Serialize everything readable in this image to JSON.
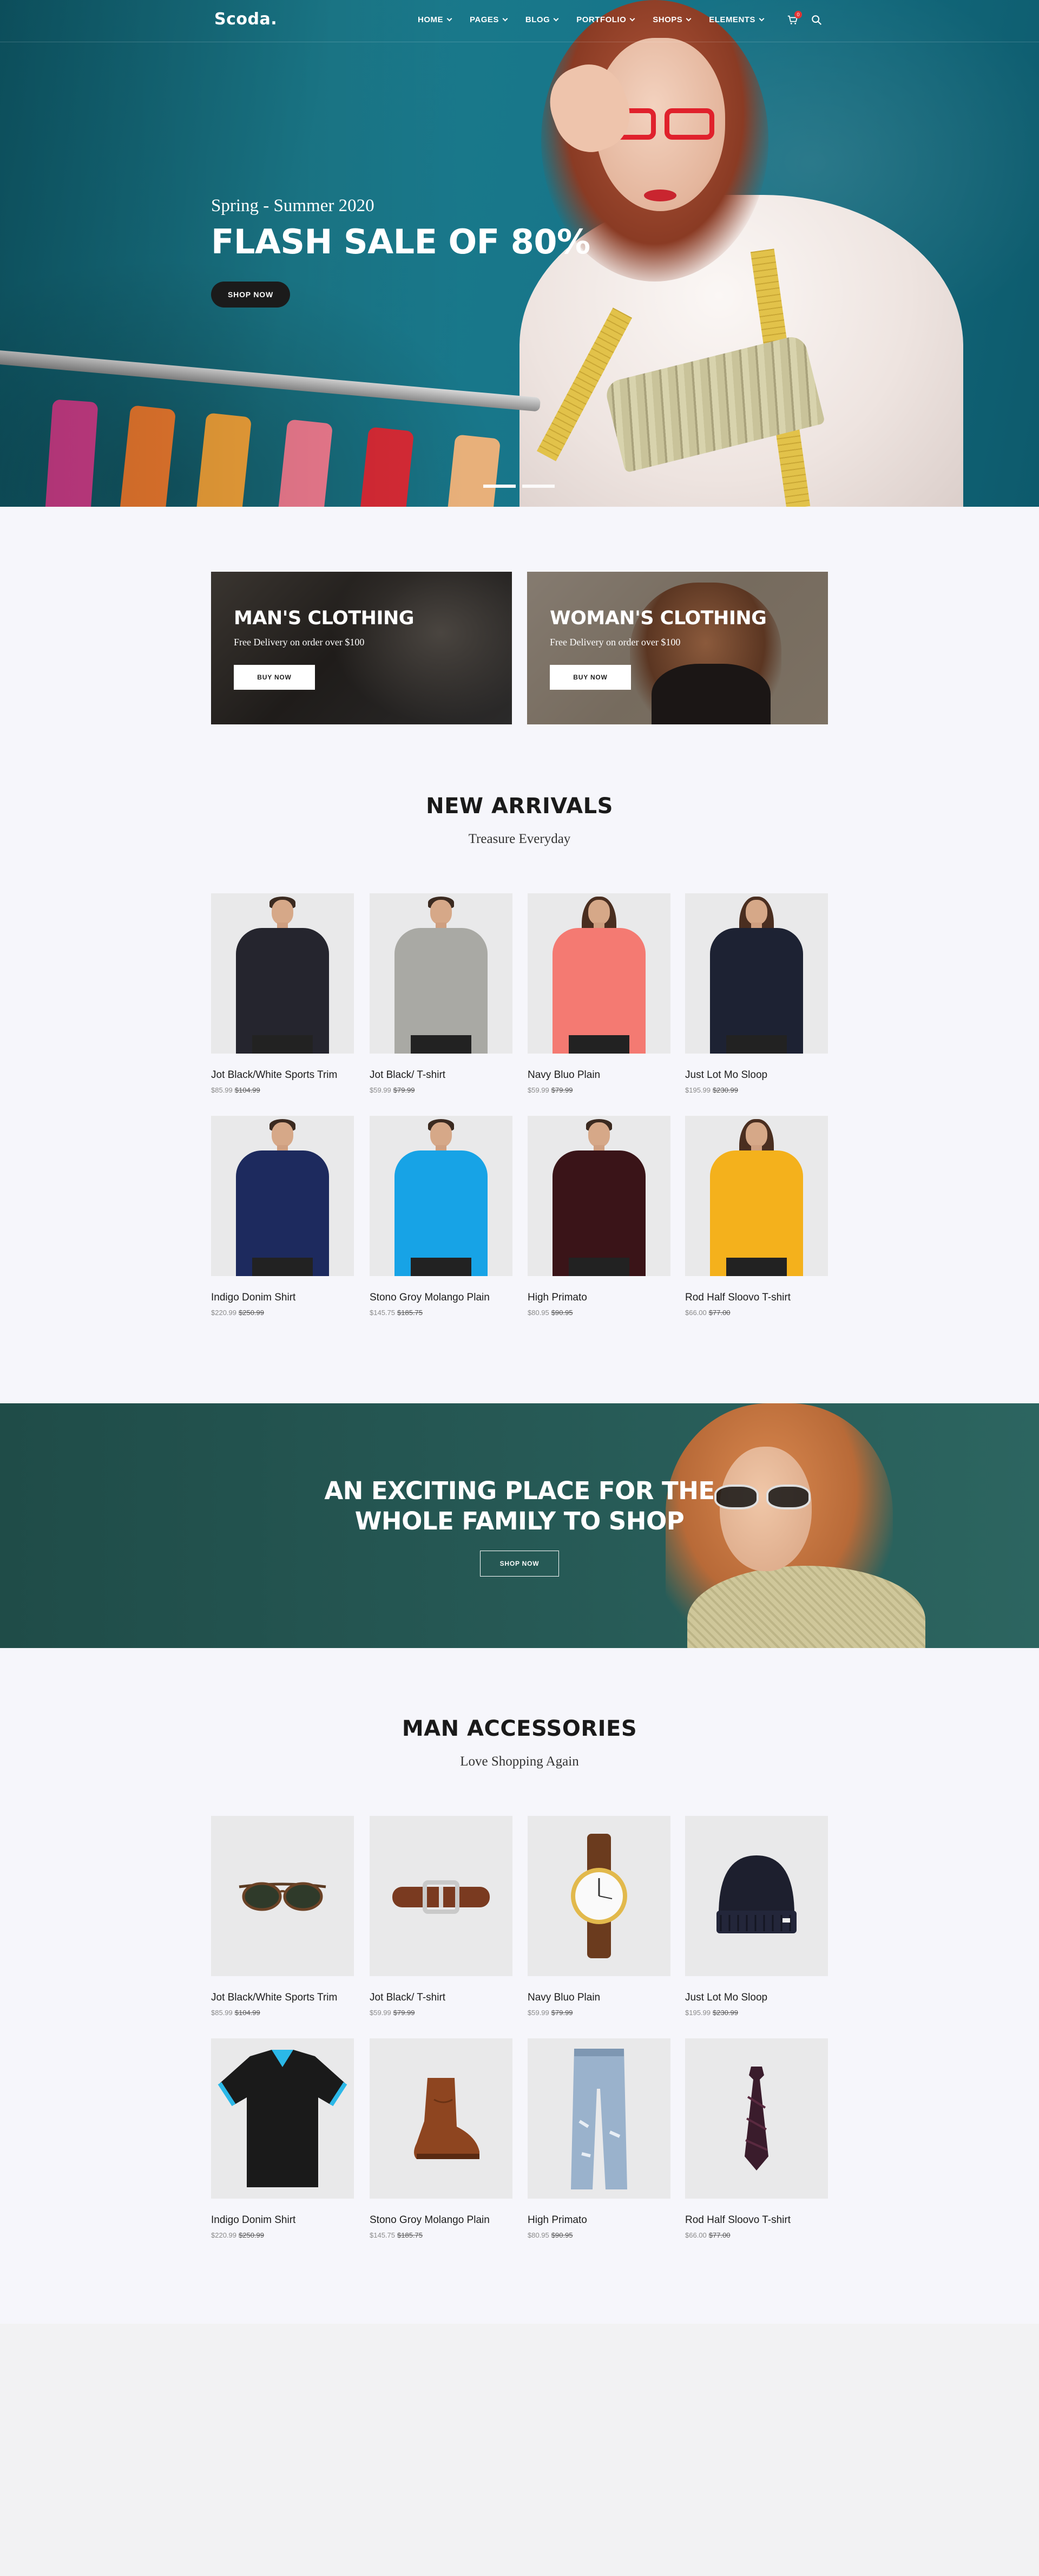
{
  "header": {
    "logo": "Scoda.",
    "nav": [
      {
        "label": "HOME"
      },
      {
        "label": "PAGES"
      },
      {
        "label": "BLOG"
      },
      {
        "label": "PORTFOLIO"
      },
      {
        "label": "SHOPS"
      },
      {
        "label": "ELEMENTS"
      }
    ],
    "cart_count": "0"
  },
  "hero": {
    "subtitle": "Spring - Summer 2020",
    "title": "FLASH SALE OF 80%",
    "button": "SHOP NOW"
  },
  "categories": [
    {
      "title": "MAN'S CLOTHING",
      "subtitle": "Free Delivery on order over $100",
      "button": "BUY NOW"
    },
    {
      "title": "WOMAN'S CLOTHING",
      "subtitle": "Free Delivery on order over $100",
      "button": "BUY NOW"
    }
  ],
  "new_arrivals": {
    "title": "NEW ARRIVALS",
    "subtitle": "Treasure Everyday",
    "products": [
      {
        "name": "Jot Black/White Sports Trim",
        "price": "$85.99",
        "old_price": "$104.99",
        "color": "#25252e"
      },
      {
        "name": "Jot Black/ T-shirt",
        "price": "$59.99",
        "old_price": "$79.99",
        "color": "#a9a9a4"
      },
      {
        "name": "Navy Bluo Plain",
        "price": "$59.99",
        "old_price": "$79.99",
        "color": "#f47a72"
      },
      {
        "name": "Just Lot Mo Sloop",
        "price": "$195.99",
        "old_price": "$230.99",
        "color": "#1d2233"
      },
      {
        "name": "Indigo Donim Shirt",
        "price": "$220.99",
        "old_price": "$250.99",
        "color": "#1d2a5e"
      },
      {
        "name": "Stono Groy Molango Plain",
        "price": "$145.75",
        "old_price": "$185.75",
        "color": "#17a3e6"
      },
      {
        "name": "High Primato",
        "price": "$80.95",
        "old_price": "$90.95",
        "color": "#3a1418"
      },
      {
        "name": "Rod Half Sloovo T-shirt",
        "price": "$66.00",
        "old_price": "$77.00",
        "color": "#f4b11c"
      }
    ]
  },
  "promo": {
    "title_line1": "AN EXCITING PLACE FOR THE",
    "title_line2": "WHOLE FAMILY TO SHOP",
    "button": "SHOP NOW"
  },
  "accessories": {
    "title": "MAN ACCESSORIES",
    "subtitle": "Love Shopping Again",
    "products": [
      {
        "name": "Jot Black/White Sports Trim",
        "price": "$85.99",
        "old_price": "$104.99",
        "icon": "sunglasses-icon"
      },
      {
        "name": "Jot Black/ T-shirt",
        "price": "$59.99",
        "old_price": "$79.99",
        "icon": "belt-icon"
      },
      {
        "name": "Navy Bluo Plain",
        "price": "$59.99",
        "old_price": "$79.99",
        "icon": "watch-icon"
      },
      {
        "name": "Just Lot Mo Sloop",
        "price": "$195.99",
        "old_price": "$230.99",
        "icon": "beanie-icon"
      },
      {
        "name": "Indigo Donim Shirt",
        "price": "$220.99",
        "old_price": "$250.99",
        "icon": "polo-shirt-icon"
      },
      {
        "name": "Stono Groy Molango Plain",
        "price": "$145.75",
        "old_price": "$185.75",
        "icon": "boot-icon"
      },
      {
        "name": "High Primato",
        "price": "$80.95",
        "old_price": "$90.95",
        "icon": "jeans-icon"
      },
      {
        "name": "Rod Half Sloovo T-shirt",
        "price": "$66.00",
        "old_price": "$77.00",
        "icon": "tie-icon"
      }
    ]
  }
}
